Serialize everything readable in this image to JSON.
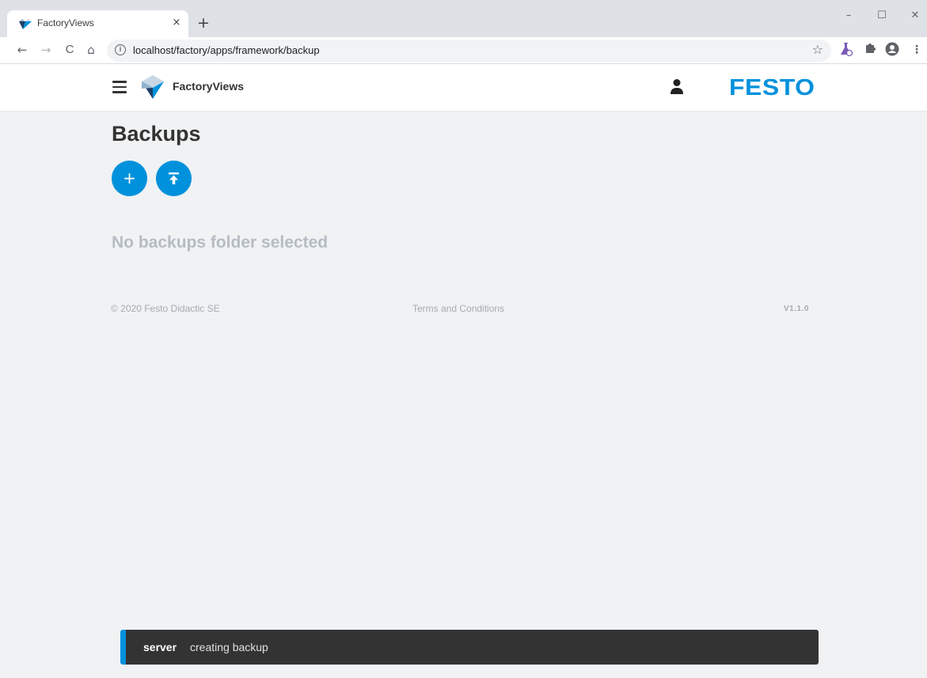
{
  "browser": {
    "tab_title": "FactoryViews",
    "tab_close": "×",
    "new_tab": "+",
    "url": "localhost/factory/apps/framework/backup",
    "window_controls": {
      "minimize": "–",
      "maximize": "☐",
      "close": "✕"
    },
    "nav": {
      "back": "←",
      "forward": "→",
      "reload": "C",
      "home": "⌂"
    }
  },
  "header": {
    "app_name": "FactoryViews",
    "brand": "FESTO"
  },
  "page": {
    "title": "Backups",
    "add_button": "+",
    "empty_message": "No backups folder selected"
  },
  "footer": {
    "copyright": "© 2020 Festo Didactic SE",
    "terms": "Terms and Conditions",
    "version": "V1.1.0"
  },
  "snackbar": {
    "source": "server",
    "message": "creating backup"
  },
  "colors": {
    "accent": "#0091dc",
    "background": "#f0f2f4",
    "snackbar": "#333333"
  }
}
